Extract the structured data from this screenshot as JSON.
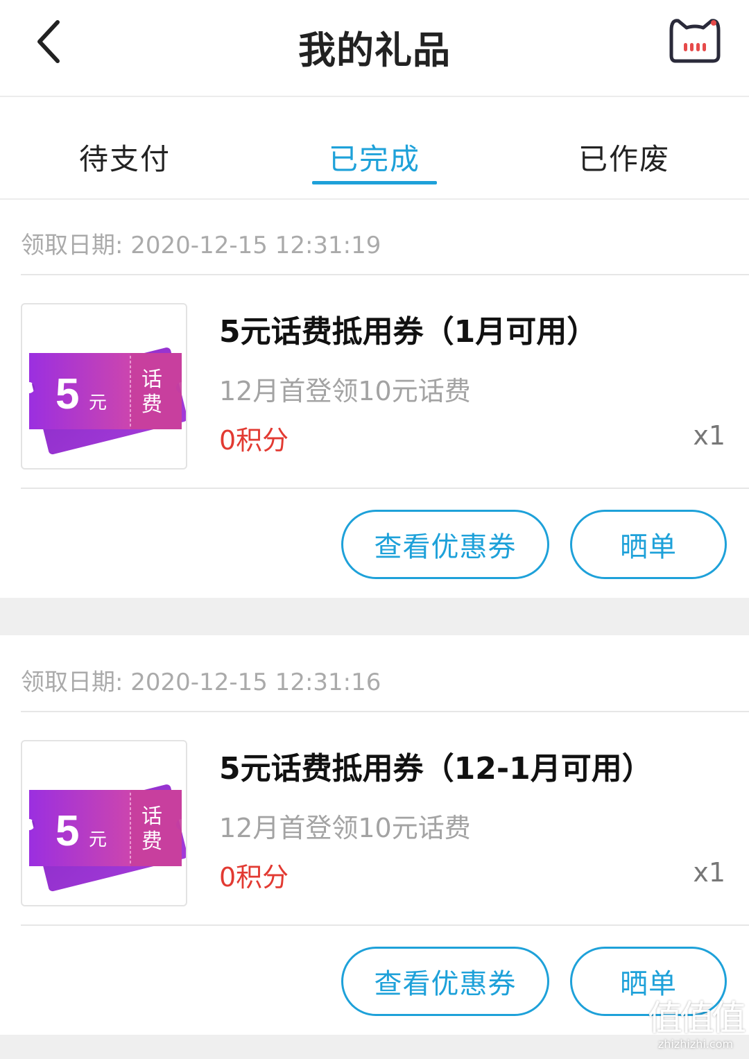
{
  "header": {
    "title": "我的礼品",
    "back_icon": "chevron-left-icon",
    "profile_icon": "cat-face-icon"
  },
  "tabs": [
    {
      "label": "待支付",
      "active": false
    },
    {
      "label": "已完成",
      "active": true
    },
    {
      "label": "已作废",
      "active": false
    }
  ],
  "colors": {
    "accent": "#1ea1d9",
    "points_red": "#e23a32",
    "muted_text": "#aaaaaa",
    "ticket_purple": "#a52fd8",
    "ticket_pink": "#e0459c"
  },
  "gifts": [
    {
      "date_label": "领取日期:",
      "date": "2020-12-15 12:31:19",
      "thumb": {
        "amount": "5",
        "unit": "元",
        "tag_line1": "话",
        "tag_line2": "费"
      },
      "title": "5元话费抵用券（1月可用）",
      "subtitle": "12月首登领10元话费",
      "points": "0积分",
      "quantity": "x1",
      "coupon_button": "查看优惠券",
      "share_button": "晒单"
    },
    {
      "date_label": "领取日期:",
      "date": "2020-12-15 12:31:16",
      "thumb": {
        "amount": "5",
        "unit": "元",
        "tag_line1": "话",
        "tag_line2": "费"
      },
      "title": "5元话费抵用券（12-1月可用）",
      "subtitle": "12月首登领10元话费",
      "points": "0积分",
      "quantity": "x1",
      "coupon_button": "查看优惠券",
      "share_button": "晒单"
    }
  ],
  "watermark": {
    "logo": "值值值",
    "url": "zhizhizhi.com"
  }
}
